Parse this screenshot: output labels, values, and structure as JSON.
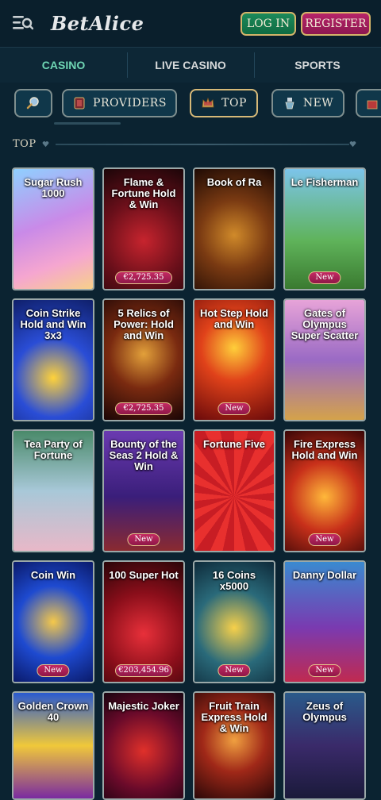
{
  "header": {
    "logo": "BetAlice",
    "login_label": "LOG IN",
    "register_label": "REGISTER"
  },
  "topnav": {
    "tabs": [
      {
        "label": "CASINO",
        "active": true
      },
      {
        "label": "LIVE CASINO",
        "active": false
      },
      {
        "label": "SPORTS",
        "active": false
      }
    ]
  },
  "filters": {
    "search_icon": "search-icon",
    "providers_label": "PROVIDERS",
    "top_label": "TOP",
    "new_label": "NEW"
  },
  "section": {
    "title": "TOP"
  },
  "games": [
    {
      "name": "Sugar Rush 1000",
      "badge": ""
    },
    {
      "name": "Flame & Fortune Hold & Win",
      "badge": "€2,725.35"
    },
    {
      "name": "Book of Ra",
      "badge": ""
    },
    {
      "name": "Le Fisherman",
      "badge": "New"
    },
    {
      "name": "Coin Strike Hold and Win 3x3",
      "badge": ""
    },
    {
      "name": "5 Relics of Power: Hold and Win",
      "badge": "€2,725.35"
    },
    {
      "name": "Hot Step Hold and Win",
      "badge": "New"
    },
    {
      "name": "Gates of Olympus Super Scatter",
      "badge": ""
    },
    {
      "name": "Tea Party of Fortune",
      "badge": ""
    },
    {
      "name": "Bounty of the Seas 2 Hold & Win",
      "badge": "New"
    },
    {
      "name": "Fortune Five",
      "badge": ""
    },
    {
      "name": "Fire Express Hold and Win",
      "badge": "New"
    },
    {
      "name": "Coin Win",
      "badge": "New"
    },
    {
      "name": "100 Super Hot",
      "badge": "€203,454.96"
    },
    {
      "name": "16 Coins x5000",
      "badge": "New"
    },
    {
      "name": "Danny Dollar",
      "badge": "New"
    },
    {
      "name": "Golden Crown 40",
      "badge": ""
    },
    {
      "name": "Majestic Joker",
      "badge": ""
    },
    {
      "name": "Fruit Train Express Hold & Win",
      "badge": ""
    },
    {
      "name": "Zeus of Olympus",
      "badge": ""
    }
  ],
  "colors": {
    "background": "#0b2331",
    "accent_green": "#6fd6b4",
    "login_green": "#1c8a5a",
    "register_pink": "#b7246a",
    "gold_border": "#d4b46a"
  }
}
